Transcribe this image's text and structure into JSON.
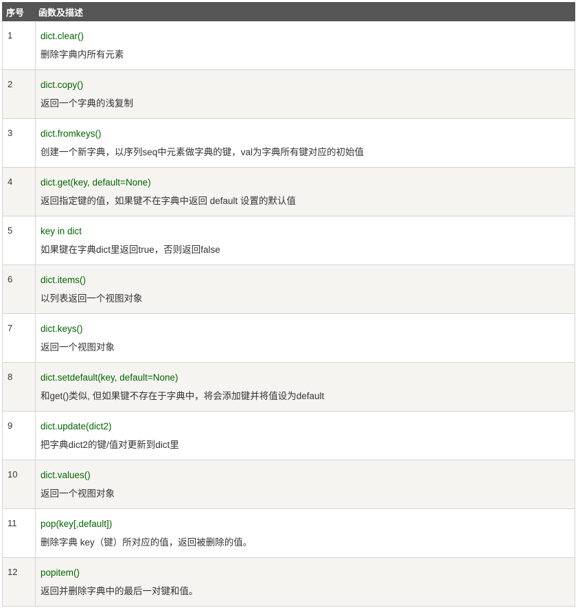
{
  "table": {
    "headers": {
      "index": "序号",
      "function": "函数及描述"
    },
    "rows": [
      {
        "num": "1",
        "func": "dict.clear()",
        "desc": "删除字典内所有元素"
      },
      {
        "num": "2",
        "func": "dict.copy()",
        "desc": "返回一个字典的浅复制"
      },
      {
        "num": "3",
        "func": "dict.fromkeys()",
        "desc": "创建一个新字典，以序列seq中元素做字典的键，val为字典所有键对应的初始值"
      },
      {
        "num": "4",
        "func": "dict.get(key, default=None)",
        "desc": "返回指定键的值，如果键不在字典中返回 default 设置的默认值"
      },
      {
        "num": "5",
        "func": "key in dict",
        "desc": "如果键在字典dict里返回true，否则返回false"
      },
      {
        "num": "6",
        "func": "dict.items()",
        "desc": "以列表返回一个视图对象"
      },
      {
        "num": "7",
        "func": "dict.keys()",
        "desc": "返回一个视图对象"
      },
      {
        "num": "8",
        "func": "dict.setdefault(key, default=None)",
        "desc": "和get()类似, 但如果键不存在于字典中，将会添加键并将值设为default"
      },
      {
        "num": "9",
        "func": "dict.update(dict2)",
        "desc": "把字典dict2的键/值对更新到dict里"
      },
      {
        "num": "10",
        "func": "dict.values()",
        "desc": "返回一个视图对象"
      },
      {
        "num": "11",
        "func": "pop(key[,default])",
        "desc": "删除字典 key（键）所对应的值，返回被删除的值。"
      },
      {
        "num": "12",
        "func": "popitem()",
        "desc": "返回并删除字典中的最后一对键和值。"
      }
    ]
  },
  "colors": {
    "header_bg": "#555555",
    "header_text": "#ffffff",
    "function_text": "#006600",
    "row_alt_bg": "#f6f4f0",
    "border": "#d4d4d4"
  }
}
